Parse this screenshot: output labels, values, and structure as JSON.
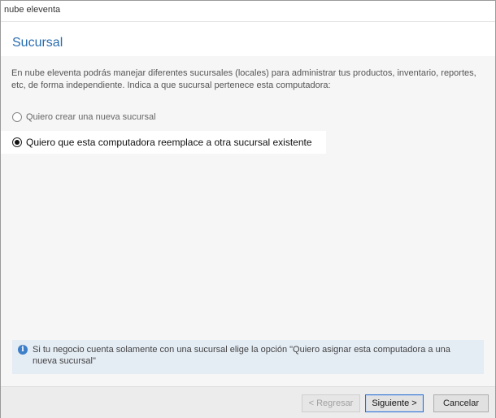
{
  "window": {
    "title": "nube eleventa"
  },
  "page": {
    "title": "Sucursal",
    "intro": "En nube eleventa podrás manejar diferentes sucursales (locales) para administrar tus productos, inventario, reportes, etc, de forma independiente. Indica a que sucursal pertenece esta computadora:"
  },
  "options": [
    {
      "label": "Quiero crear una nueva sucursal",
      "selected": false
    },
    {
      "label": "Quiero que esta computadora reemplace a otra sucursal existente",
      "selected": true
    }
  ],
  "info": {
    "icon": "info-icon",
    "text": "Si tu negocio cuenta solamente con una sucursal elige la opción \"Quiero asignar esta computadora a una nueva sucursal\""
  },
  "buttons": {
    "back_label": "< Regresar",
    "next_label": "Siguiente >",
    "cancel_label": "Cancelar"
  },
  "colors": {
    "title_blue": "#2a6db0",
    "info_background": "#e4ecf4",
    "focus_border": "#2b6fd1"
  }
}
